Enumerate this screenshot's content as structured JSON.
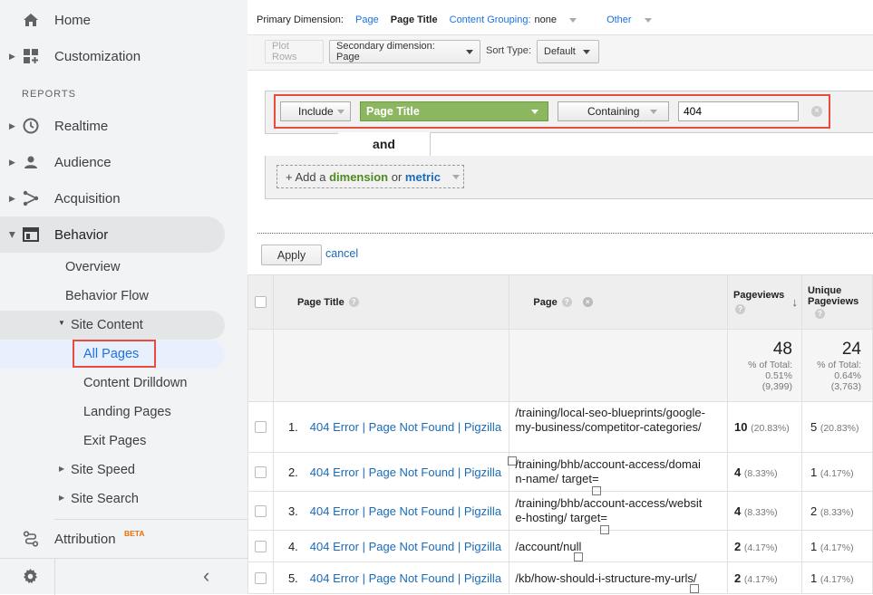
{
  "sidebar": {
    "home": "Home",
    "customization": "Customization",
    "reports_label": "REPORTS",
    "realtime": "Realtime",
    "audience": "Audience",
    "acquisition": "Acquisition",
    "behavior": "Behavior",
    "behavior_children": {
      "overview": "Overview",
      "behavior_flow": "Behavior Flow",
      "site_content": "Site Content",
      "all_pages": "All Pages",
      "content_drilldown": "Content Drilldown",
      "landing_pages": "Landing Pages",
      "exit_pages": "Exit Pages",
      "site_speed": "Site Speed",
      "site_search": "Site Search"
    },
    "attribution": "Attribution",
    "attribution_badge": "BETA",
    "collapse_glyph": "‹"
  },
  "dimension_bar": {
    "label": "Primary Dimension:",
    "page": "Page",
    "page_title": "Page Title",
    "content_grouping": "Content Grouping:",
    "content_grouping_value": "none",
    "other": "Other"
  },
  "toolbar": {
    "plot_rows": "Plot Rows",
    "secondary_dimension": "Secondary dimension: Page",
    "sort_type_label": "Sort Type:",
    "sort_type_value": "Default"
  },
  "filter": {
    "include": "Include",
    "dimension": "Page Title",
    "match_type": "Containing",
    "value": "404",
    "and_label": "and",
    "add_prefix": "+ Add a",
    "add_dimension": "dimension",
    "add_or": "or",
    "add_metric": "metric",
    "apply": "Apply",
    "cancel": "cancel"
  },
  "table": {
    "columns": {
      "page_title": "Page Title",
      "page": "Page",
      "pageviews": "Pageviews",
      "unique_pageviews_1": "Unique",
      "unique_pageviews_2": "Pageviews"
    },
    "totals": {
      "pageviews": "48",
      "pageviews_pct_label": "% of Total:",
      "pageviews_pct": "0.51%",
      "pageviews_total": "(9,399)",
      "unique": "24",
      "unique_pct_label": "% of Total:",
      "unique_pct": "0.64%",
      "unique_total": "(3,763)"
    },
    "rows": [
      {
        "index": "1.",
        "title": "404 Error | Page Not Found | Pigzilla",
        "page": "/training/local-seo-blueprints/google-my-business/competitor-categories/",
        "pageviews": "10",
        "pv_pct": "(20.83%)",
        "unique": "5",
        "u_pct": "(20.83%)"
      },
      {
        "index": "2.",
        "title": "404 Error | Page Not Found | Pigzilla",
        "page": "/training/bhb/account-access/domain-name/ target=",
        "pageviews": "4",
        "pv_pct": "(8.33%)",
        "unique": "1",
        "u_pct": "(4.17%)"
      },
      {
        "index": "3.",
        "title": "404 Error | Page Not Found | Pigzilla",
        "page": "/training/bhb/account-access/website-hosting/ target=",
        "pageviews": "4",
        "pv_pct": "(8.33%)",
        "unique": "2",
        "u_pct": "(8.33%)"
      },
      {
        "index": "4.",
        "title": "404 Error | Page Not Found | Pigzilla",
        "page": "/account/null",
        "pageviews": "2",
        "pv_pct": "(4.17%)",
        "unique": "1",
        "u_pct": "(4.17%)"
      },
      {
        "index": "5.",
        "title": "404 Error | Page Not Found | Pigzilla",
        "page": "/kb/how-should-i-structure-my-urls/",
        "pageviews": "2",
        "pv_pct": "(4.17%)",
        "unique": "1",
        "u_pct": "(4.17%)"
      }
    ]
  },
  "colors": {
    "accent": "#1a73e8",
    "highlight_red": "#e74c3c",
    "dimension_green": "#8db660",
    "link_blue": "#1a6bb8"
  }
}
